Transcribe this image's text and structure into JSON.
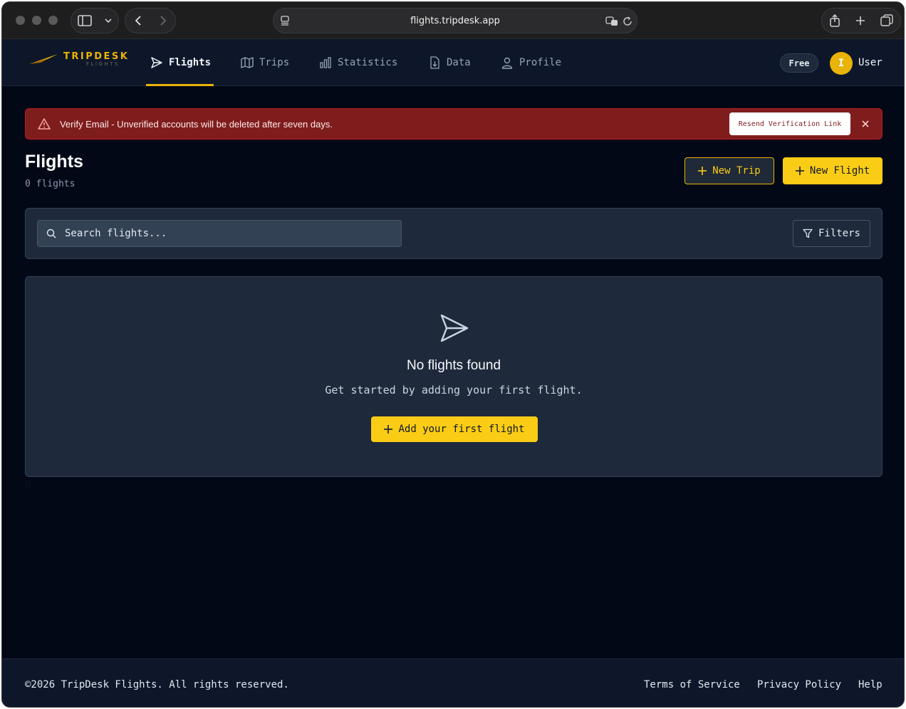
{
  "browser": {
    "url": "flights.tripdesk.app"
  },
  "brand": {
    "name": "TRIPDESK",
    "sub": "FLIGHTS",
    "accent_color": "#eab308"
  },
  "nav": {
    "items": [
      {
        "label": "Flights",
        "icon": "plane-send-icon",
        "active": true
      },
      {
        "label": "Trips",
        "icon": "map-icon",
        "active": false
      },
      {
        "label": "Statistics",
        "icon": "bar-chart-icon",
        "active": false
      },
      {
        "label": "Data",
        "icon": "file-download-icon",
        "active": false
      },
      {
        "label": "Profile",
        "icon": "user-icon",
        "active": false
      }
    ],
    "plan_badge": "Free",
    "avatar_initial": "I",
    "user_name": "User"
  },
  "alert": {
    "message": "Verify Email - Unverified accounts will be deleted after seven days.",
    "action_label": "Resend Verification Link",
    "color": "#7f1d1d"
  },
  "page": {
    "title": "Flights",
    "count_text": "0 flights",
    "new_trip_label": "New Trip",
    "new_flight_label": "New Flight"
  },
  "search": {
    "placeholder": "Search flights...",
    "value": "",
    "filters_label": "Filters"
  },
  "empty_state": {
    "title": "No flights found",
    "subtitle": "Get started by adding your first flight.",
    "button_label": "Add your first flight"
  },
  "stray_text": "0",
  "footer": {
    "copyright": "©2026 TripDesk Flights. All rights reserved.",
    "links": [
      "Terms of Service",
      "Privacy Policy",
      "Help"
    ]
  }
}
